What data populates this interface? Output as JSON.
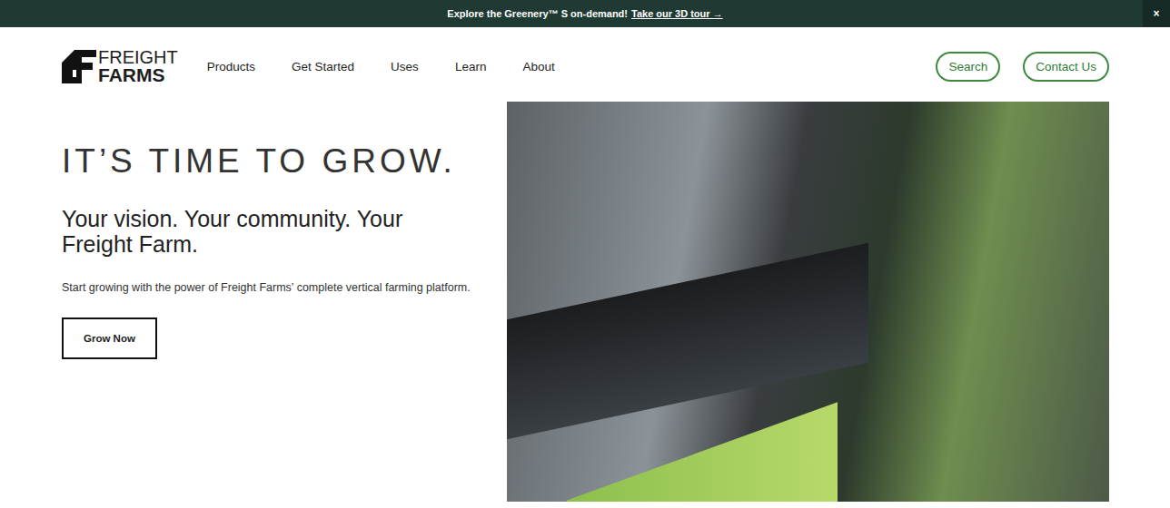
{
  "banner": {
    "text": "Explore the Greenery™ S on-demand!",
    "link": "Take our 3D tour →",
    "close": "×"
  },
  "logo": {
    "line1": "FREIGHT",
    "line2": "FARMS"
  },
  "nav": [
    "Products",
    "Get Started",
    "Uses",
    "Learn",
    "About"
  ],
  "actions": [
    "Search",
    "Contact Us"
  ],
  "hero": {
    "title": "IT’S TIME TO GROW.",
    "subtitle": "Your vision. Your community. Your Freight Farm.",
    "body": "Start growing with the power of Freight Farms’ complete vertical farming platform.",
    "cta": "Grow Now"
  }
}
